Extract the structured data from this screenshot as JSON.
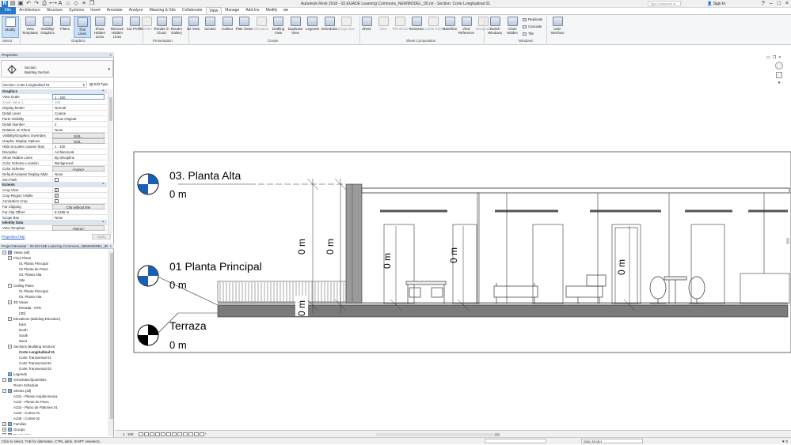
{
  "app": {
    "title": "Autodesk Revit 2018 -    02.EGADE Learning Commons_NEWMODEL_05.rvt - Section: Corte Longitudinal 01",
    "search_placeholder": "Type a keyword or phrase",
    "user": "Sign In",
    "help": "?"
  },
  "tabs": [
    "File",
    "Architecture",
    "Structure",
    "Systems",
    "Insert",
    "Annotate",
    "Analyze",
    "Massing & Site",
    "Collaborate",
    "View",
    "Manage",
    "Add-Ins",
    "Modify"
  ],
  "active_tab": "View",
  "ribbon": {
    "select": {
      "modify": "Modify",
      "label": "Select"
    },
    "graphics": {
      "buttons": [
        "View Templates",
        "Visibility/ Graphics",
        "Filters",
        "Thin Lines",
        "Show Hidden Lines",
        "Remove Hidden Lines",
        "Cut Profile"
      ],
      "label": "Graphics"
    },
    "presentation": {
      "buttons": [
        "Render",
        "Render in Cloud",
        "Render Gallery"
      ],
      "label": "Presentation"
    },
    "create": {
      "buttons": [
        "3D View",
        "Section",
        "Callout",
        "Plan Views",
        "Elevation",
        "Drafting View",
        "Duplicate View",
        "Legends",
        "Schedules",
        "Scope Box"
      ],
      "label": "Create"
    },
    "sheet_composition": {
      "buttons": [
        "Sheet",
        "View",
        "Title Block",
        "Revisions",
        "Guide Grid",
        "Matchline",
        "View Reference",
        "Viewports"
      ],
      "label": "Sheet Composition"
    },
    "windows": {
      "buttons": [
        "Switch Windows",
        "Close Hidden"
      ],
      "small": [
        "Replicate",
        "Cascade",
        "Tile"
      ],
      "label": "Windows"
    },
    "user_interface": {
      "button": "User Interface"
    }
  },
  "properties": {
    "title": "Properties",
    "type_line1": "Section",
    "type_line2": "Building Section",
    "instance": "Section: Corte Longitudinal 01",
    "edit_type": "Edit Type",
    "groups": [
      {
        "name": "Graphics",
        "rows": [
          {
            "n": "View Scale",
            "v": "1 : 100",
            "kind": "input"
          },
          {
            "n": "Scale Value    1:",
            "v": "100",
            "kind": "dim"
          },
          {
            "n": "Display Model",
            "v": "Normal"
          },
          {
            "n": "Detail Level",
            "v": "Coarse"
          },
          {
            "n": "Parts Visibility",
            "v": "Show Original"
          },
          {
            "n": "Detail Number",
            "v": "2"
          },
          {
            "n": "Rotation on Sheet",
            "v": "None"
          },
          {
            "n": "Visibility/Graphics Overrides",
            "v": "Edit...",
            "kind": "btn"
          },
          {
            "n": "Graphic Display Options",
            "v": "Edit...",
            "kind": "btn"
          },
          {
            "n": "Hide at scales coarser than",
            "v": "1 : 100"
          },
          {
            "n": "Discipline",
            "v": "Architectural"
          },
          {
            "n": "Show Hidden Lines",
            "v": "By Discipline"
          },
          {
            "n": "Color Scheme Location",
            "v": "Background"
          },
          {
            "n": "Color Scheme",
            "v": "<none>",
            "kind": "btn"
          },
          {
            "n": "Default Analysis Display Style",
            "v": "None"
          },
          {
            "n": "Sun Path",
            "v": "",
            "kind": "cb",
            "checked": false
          }
        ]
      },
      {
        "name": "Extents",
        "rows": [
          {
            "n": "Crop View",
            "v": "",
            "kind": "cb",
            "checked": true
          },
          {
            "n": "Crop Region Visible",
            "v": "",
            "kind": "cb",
            "checked": true
          },
          {
            "n": "Annotation Crop",
            "v": "",
            "kind": "cb",
            "checked": false
          },
          {
            "n": "Far Clipping",
            "v": "Clip without line",
            "kind": "btn"
          },
          {
            "n": "Far Clip Offset",
            "v": "8.3185 m"
          },
          {
            "n": "Scope Box",
            "v": "None"
          }
        ]
      },
      {
        "name": "Identity Data",
        "rows": [
          {
            "n": "View Template",
            "v": "<None>",
            "kind": "btn"
          }
        ]
      }
    ],
    "help_link": "Properties help",
    "apply": "Apply"
  },
  "project_browser": {
    "title": "Project Browser - 02.EGADE Learning Commons_NEWMODEL_05...",
    "tree": [
      {
        "d": 0,
        "t": "Views (all)",
        "tw": "−",
        "ic": true
      },
      {
        "d": 1,
        "t": "Floor Plans",
        "tw": "−"
      },
      {
        "d": 2,
        "t": "01 Planta Principal"
      },
      {
        "d": 2,
        "t": "02 Planta de Pisos"
      },
      {
        "d": 2,
        "t": "03. Planta Alta"
      },
      {
        "d": 2,
        "t": "Site"
      },
      {
        "d": 1,
        "t": "Ceiling Plans",
        "tw": "−"
      },
      {
        "d": 2,
        "t": "01 Planta Principal"
      },
      {
        "d": 2,
        "t": "03. Planta Alta"
      },
      {
        "d": 1,
        "t": "3D Views",
        "tw": "−"
      },
      {
        "d": 2,
        "t": "Entrada - NTE"
      },
      {
        "d": 2,
        "t": "{3D}"
      },
      {
        "d": 1,
        "t": "Elevations (Building Elevation)",
        "tw": "−"
      },
      {
        "d": 2,
        "t": "East"
      },
      {
        "d": 2,
        "t": "North"
      },
      {
        "d": 2,
        "t": "South"
      },
      {
        "d": 2,
        "t": "West"
      },
      {
        "d": 1,
        "t": "Sections (Building Section)",
        "tw": "−"
      },
      {
        "d": 2,
        "t": "Corte Longitudinal 01",
        "sel": true
      },
      {
        "d": 2,
        "t": "Corte Transversal 01"
      },
      {
        "d": 2,
        "t": "Corte Transversal 02"
      },
      {
        "d": 2,
        "t": "Corte Transversal 03"
      },
      {
        "d": 0,
        "t": "Legends",
        "ic": true
      },
      {
        "d": 0,
        "t": "Schedules/Quantities",
        "tw": "−",
        "ic": true
      },
      {
        "d": 1,
        "t": "Room Schedule"
      },
      {
        "d": 0,
        "t": "Sheets (all)",
        "tw": "−",
        "ic": true
      },
      {
        "d": 1,
        "t": "A101 - Planta Arquitectonica"
      },
      {
        "d": 1,
        "t": "A102 - Planta de Pisos"
      },
      {
        "d": 1,
        "t": "A103 - Plano de Plafones 01"
      },
      {
        "d": 1,
        "t": "A104 - Cortes 01"
      },
      {
        "d": 1,
        "t": "A105 - Cortes 02"
      },
      {
        "d": 0,
        "t": "Families",
        "tw": "+",
        "ic": true
      },
      {
        "d": 0,
        "t": "Groups",
        "tw": "+",
        "ic": true
      },
      {
        "d": 0,
        "t": "Revit Links",
        "tw": "+",
        "ic": true
      }
    ]
  },
  "canvas": {
    "levels": [
      {
        "name": "03. Planta Alta",
        "elev": "0 m"
      },
      {
        "name": "01 Planta Principal",
        "elev": "0 m"
      },
      {
        "name": "Terraza",
        "elev": "0 m"
      }
    ],
    "dim_labels": [
      "0 m",
      "0 m",
      "0 m",
      "0 m",
      "0 m",
      "0 m"
    ]
  },
  "view_control": {
    "scale": "1 : 100"
  },
  "status": {
    "message": "Click to select, TAB for alternates, CTRL adds, SHIFT unselects.",
    "model": "Main Model",
    "filter": ":0"
  },
  "colors": {
    "file_tab": "#2b78c9",
    "level_head_blue": "#1a5fb4",
    "ribbon_bg": "#f5f6f7",
    "panel_header": "#dde6f0"
  }
}
